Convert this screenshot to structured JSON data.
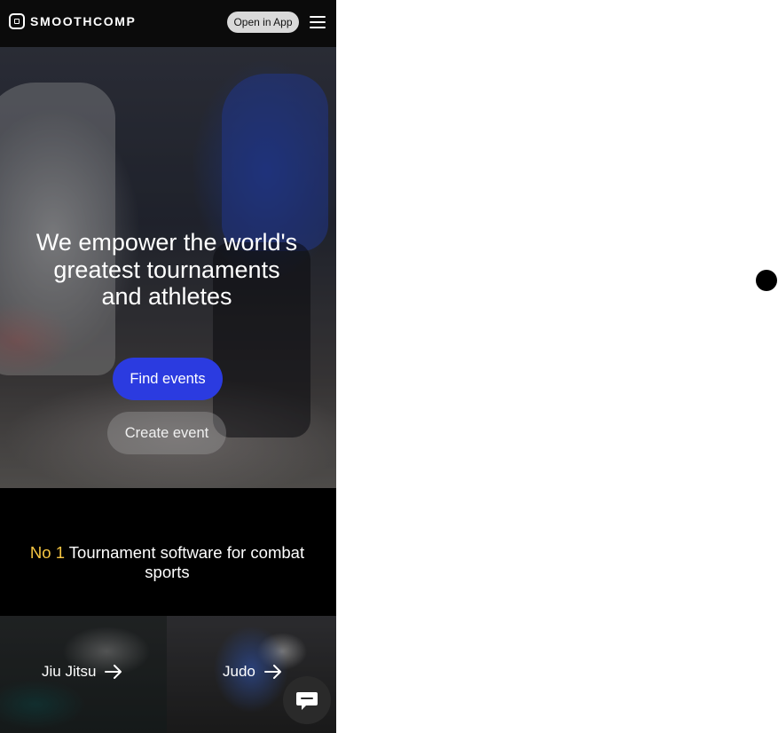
{
  "header": {
    "brand": "SMOOTHCOMP",
    "open_app_label": "Open in App"
  },
  "hero": {
    "title": "We empower the world's greatest tournaments and athletes",
    "find_events_label": "Find events",
    "create_event_label": "Create event"
  },
  "tagline": {
    "highlight": "No 1",
    "text": "Tournament software for combat sports"
  },
  "sports": [
    {
      "label": "Jiu Jitsu"
    },
    {
      "label": "Judo"
    }
  ],
  "colors": {
    "accent_blue": "#2b3be0",
    "highlight_yellow": "#f5c542",
    "background": "#000000"
  }
}
